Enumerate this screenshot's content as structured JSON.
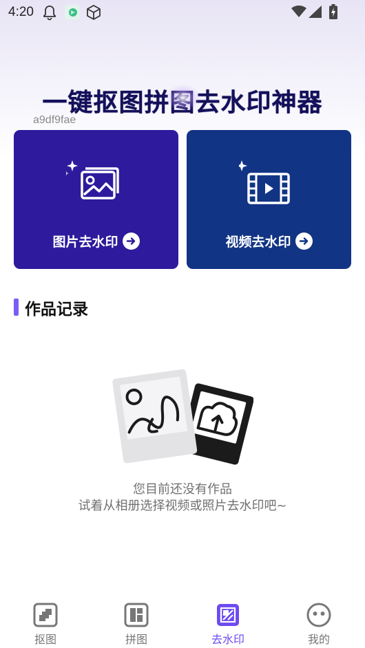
{
  "status_bar": {
    "time": "4:20",
    "icons": [
      "bell-icon",
      "app-notification-icon",
      "cube-icon",
      "wifi-icon",
      "signal-icon",
      "battery-charging-icon"
    ]
  },
  "hero": {
    "title": "一键抠图拼图去水印神器",
    "code": "a9df9fae"
  },
  "cards": [
    {
      "label": "图片去水印",
      "icon": "image-sparkle-icon",
      "color": "#2d1a9c"
    },
    {
      "label": "视频去水印",
      "icon": "video-sparkle-icon",
      "color": "#123485"
    }
  ],
  "section": {
    "title": "作品记录",
    "accent": "#7c5cf6"
  },
  "empty_state": {
    "line1": "您目前还没有作品",
    "line2": "试着从相册选择视频或照片去水印吧~"
  },
  "bottom_nav": {
    "items": [
      {
        "label": "抠图",
        "icon": "cutout-icon",
        "active": false
      },
      {
        "label": "拼图",
        "icon": "collage-icon",
        "active": false
      },
      {
        "label": "去水印",
        "icon": "remove-watermark-icon",
        "active": true
      },
      {
        "label": "我的",
        "icon": "profile-icon",
        "active": false
      }
    ],
    "active_color": "#6d4af0"
  }
}
